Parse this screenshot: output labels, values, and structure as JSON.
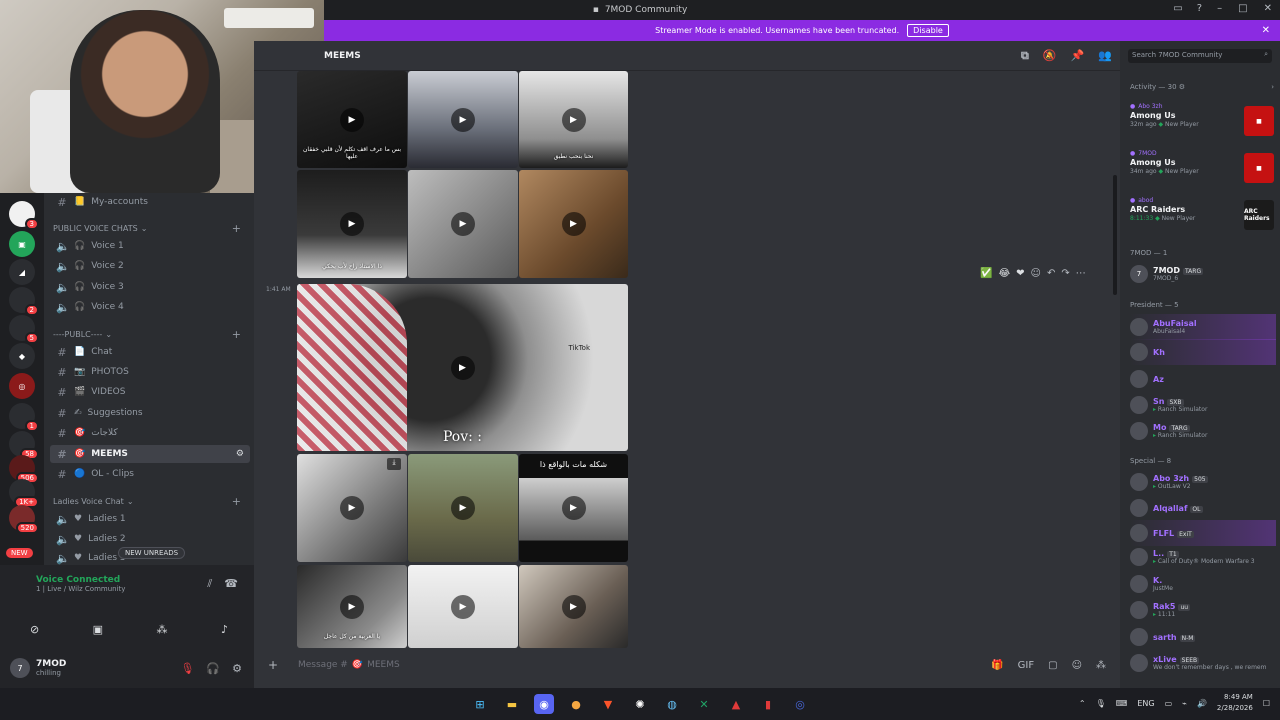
{
  "window": {
    "title": "7MOD Community"
  },
  "banner": {
    "text": "Streamer Mode is enabled. Usernames have been truncated.",
    "button": "Disable"
  },
  "server_badges": [
    "3",
    "2",
    "5",
    "1",
    "58",
    "506",
    "1K+",
    "520"
  ],
  "new_pill": "NEW",
  "channels": {
    "top_item": "My-accounts",
    "cat_voice": "PUBLIC VOICE CHATS",
    "voice": [
      "Voice 1",
      "Voice 2",
      "Voice 3",
      "Voice 4"
    ],
    "cat_public": "----PUBLC----",
    "text": [
      {
        "emoji": "📄",
        "name": "Chat"
      },
      {
        "emoji": "📷",
        "name": "PHOTOS"
      },
      {
        "emoji": "🎬",
        "name": "VIDEOS"
      },
      {
        "emoji": "✍",
        "name": "Suggestions"
      },
      {
        "emoji": "🎯",
        "name": "كلاجات"
      },
      {
        "emoji": "🎯",
        "name": "MEEMS"
      },
      {
        "emoji": "🔵",
        "name": "OL - Clips"
      }
    ],
    "cat_ladies": "Ladies Voice Chat",
    "ladies": [
      "Ladies 1",
      "Ladies 2",
      "Ladies 3"
    ],
    "new_unreads": "NEW UNREADS"
  },
  "voice_panel": {
    "title": "Voice Connected",
    "subtitle": "1 | Live / Wilz Community"
  },
  "user": {
    "name": "7MOD",
    "status": "chilling"
  },
  "header": {
    "channel": "MEEMS"
  },
  "media": {
    "captions": [
      "بس ما عرف اقف تكلم لأن قلبي خفقان عليها",
      "",
      "نحنا بنحب نطبق",
      "ذا الاستاذ راح لأب يحكي",
      "",
      "",
      "",
      "",
      "",
      "شكله مات بالواقع ذا",
      "يا العربية من كل عاجل",
      "",
      ""
    ],
    "pov": "Pov: :",
    "watermark": "TikTok",
    "timestamp": "1:41 AM"
  },
  "composer": {
    "placeholder": "Message #",
    "channel": "MEEMS"
  },
  "members": {
    "search": "Search 7MOD Community",
    "activity_header": "Activity — 30",
    "activities": [
      {
        "who": "Abo 3zh",
        "game": "Among Us",
        "time": "32m ago",
        "tag": "New Player",
        "color": "#c51111",
        "art": "AMONG US"
      },
      {
        "who": "7MOD",
        "game": "Among Us",
        "time": "34m ago",
        "tag": "New Player",
        "color": "#c51111",
        "art": "AMONG US"
      },
      {
        "who": "abod",
        "game": "ARC Raiders",
        "time": "8:11:33",
        "tag": "New Player",
        "color": "#1b1b1b",
        "art": "ARC Raiders"
      }
    ],
    "sections": [
      {
        "label": "7MOD — 1",
        "items": [
          {
            "name": "7MOD",
            "tag": "TARG",
            "sub": "7MOD_6",
            "color": "#f2f3f5"
          }
        ]
      },
      {
        "label": "President — 5",
        "items": [
          {
            "name": "AbuFaisal",
            "tag": "",
            "sub": "AbuFaisal4",
            "color": "#a270ff"
          },
          {
            "name": "Kh",
            "tag": "",
            "sub": "",
            "color": "#a270ff"
          },
          {
            "name": "Az",
            "tag": "",
            "sub": "",
            "color": "#a270ff"
          },
          {
            "name": "Sn",
            "tag": "SXB",
            "sub": "Ranch Simulator",
            "color": "#a270ff"
          },
          {
            "name": "Mo",
            "tag": "TARG",
            "sub": "Ranch Simulator",
            "color": "#a270ff"
          }
        ]
      },
      {
        "label": "Special — 8",
        "items": [
          {
            "name": "Abo 3zh",
            "tag": "505",
            "sub": "OutLaw V2",
            "color": "#a270ff"
          },
          {
            "name": "Alqallaf",
            "tag": "OL",
            "sub": "",
            "color": "#a270ff"
          },
          {
            "name": "FLFL",
            "tag": "ExiT",
            "sub": "",
            "color": "#a270ff"
          },
          {
            "name": "L..",
            "tag": "T1",
            "sub": "Call of Duty® Modern Warfare 3",
            "color": "#a270ff"
          },
          {
            "name": "K.",
            "tag": "",
            "sub": "JustMe",
            "color": "#a270ff"
          },
          {
            "name": "Rak5",
            "tag": "uu",
            "sub": "11:11",
            "color": "#a270ff"
          },
          {
            "name": "sarth",
            "tag": "N-M",
            "sub": "",
            "color": "#a270ff"
          },
          {
            "name": "xLive",
            "tag": "SEEB",
            "sub": "We don't remember days , we remem",
            "color": "#a270ff"
          }
        ]
      }
    ]
  },
  "taskbar": {
    "lang": "ENG",
    "time": "8:49 AM",
    "date": "2/28/2026"
  }
}
